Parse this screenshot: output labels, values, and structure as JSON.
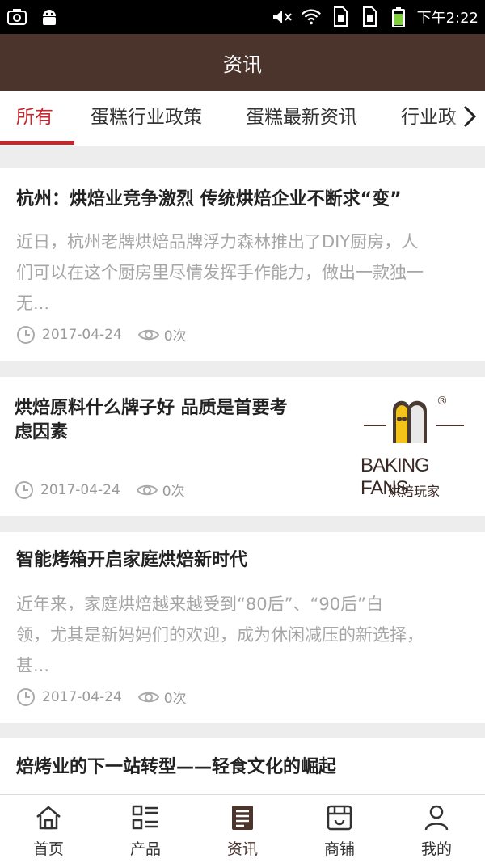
{
  "status_bar": {
    "time": "下午2:22",
    "left_icons": [
      "camera-icon",
      "android-icon"
    ],
    "right_icons": [
      "mute-icon",
      "wifi-icon",
      "sim1-icon",
      "sim2-icon",
      "battery-icon"
    ]
  },
  "header": {
    "title": "资讯"
  },
  "tabs": [
    {
      "label": "所有",
      "active": true
    },
    {
      "label": "蛋糕行业政策",
      "active": false
    },
    {
      "label": "蛋糕最新资讯",
      "active": false
    },
    {
      "label": "行业政",
      "active": false
    }
  ],
  "articles": [
    {
      "title": "杭州：烘焙业竞争激烈 传统烘焙企业不断求“变”",
      "summary_lines": [
        "近日，杭州老牌烘焙品牌浮力森林推出了DIY厨房，人",
        "们可以在这个厨房里尽情发挥手作能力，做出一款独一",
        "无..."
      ],
      "date": "2017-04-24",
      "views": "0次"
    },
    {
      "title_lines": [
        "烘焙原料什么牌子好 品质是首要考",
        "虑因素"
      ],
      "date": "2017-04-24",
      "views": "0次",
      "thumb": {
        "brand": "BAKING FANS",
        "sub": "烘焙玩家",
        "mark": "®"
      }
    },
    {
      "title": "智能烤箱开启家庭烘焙新时代",
      "summary_lines": [
        "近年来，家庭烘焙越来越受到“80后”、“90后”白",
        "领，尤其是新妈妈们的欢迎，成为休闲减压的新选择，",
        "甚..."
      ],
      "date": "2017-04-24",
      "views": "0次"
    },
    {
      "title": "焙烤业的下一站转型——轻食文化的崛起"
    }
  ],
  "bottom_nav": [
    {
      "label": "首页",
      "icon": "home-icon",
      "active": false
    },
    {
      "label": "产品",
      "icon": "product-list-icon",
      "active": false
    },
    {
      "label": "资讯",
      "icon": "news-icon",
      "active": true
    },
    {
      "label": "商铺",
      "icon": "shop-icon",
      "active": false
    },
    {
      "label": "我的",
      "icon": "user-icon",
      "active": false
    }
  ],
  "colors": {
    "header_bg": "#4a342c",
    "accent": "#c6262c",
    "page_bg": "#ededed"
  }
}
